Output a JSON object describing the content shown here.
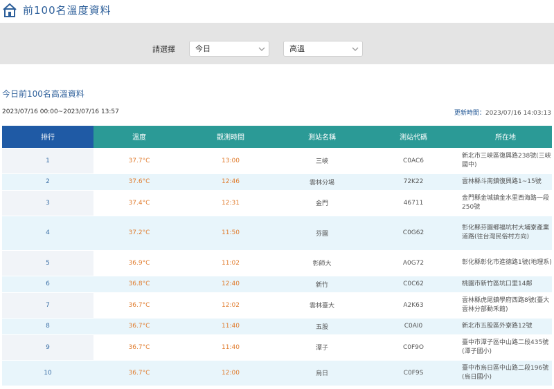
{
  "header": {
    "title": "前100名溫度資料"
  },
  "filter": {
    "label": "請選擇",
    "day_value": "今日",
    "type_value": "高溫"
  },
  "section": {
    "heading": "今日前100名高溫資料",
    "range": "2023/07/16 00:00~2023/07/16 13:57",
    "updated_label": "更新時間：",
    "updated_value": "2023/07/16 14:03:13"
  },
  "table": {
    "columns": [
      "排行",
      "溫度",
      "觀測時間",
      "測站名稱",
      "測站代碼",
      "所在地"
    ],
    "rows": [
      {
        "rank": "1",
        "temp": "37.7°C",
        "time": "13:00",
        "station": "三峽",
        "code": "C0AC6",
        "location": "新北市三峽區復興路238號(三峽國中)"
      },
      {
        "rank": "2",
        "temp": "37.6°C",
        "time": "12:46",
        "station": "雲林分場",
        "code": "72K22",
        "location": "雲林縣斗南鎮復興路1~15號"
      },
      {
        "rank": "3",
        "temp": "37.4°C",
        "time": "12:31",
        "station": "金門",
        "code": "46711",
        "location": "金門縣金城鎮金水里西海路一段250號"
      },
      {
        "rank": "4",
        "temp": "37.2°C",
        "time": "11:50",
        "station": "芬園",
        "code": "C0G62",
        "location": "彰化縣芬園鄉福坑村大埔寮產業道路(往台灣民俗村方向)"
      },
      {
        "rank": "5",
        "temp": "36.9°C",
        "time": "11:02",
        "station": "彰師大",
        "code": "A0G72",
        "location": "彰化縣彰化市進德路1號(地理系)"
      },
      {
        "rank": "6",
        "temp": "36.8°C",
        "time": "12:40",
        "station": "新竹",
        "code": "C0C62",
        "location": "桃園市新竹區坑口里14鄰"
      },
      {
        "rank": "7",
        "temp": "36.7°C",
        "time": "12:02",
        "station": "雲林臺大",
        "code": "A2K63",
        "location": "雲林縣虎尾鎮學府西路8號(臺大雲林分部動禾館)"
      },
      {
        "rank": "8",
        "temp": "36.7°C",
        "time": "11:40",
        "station": "五股",
        "code": "C0AI0",
        "location": "新北市五股區外寮路12號"
      },
      {
        "rank": "9",
        "temp": "36.7°C",
        "time": "11:40",
        "station": "潭子",
        "code": "C0F9O",
        "location": "臺中市潭子區中山路二段435號(潭子國小)"
      },
      {
        "rank": "10",
        "temp": "36.7°C",
        "time": "12:00",
        "station": "烏日",
        "code": "C0F9S",
        "location": "臺中市烏日區中山路二段196號(烏日國小)"
      }
    ]
  }
}
